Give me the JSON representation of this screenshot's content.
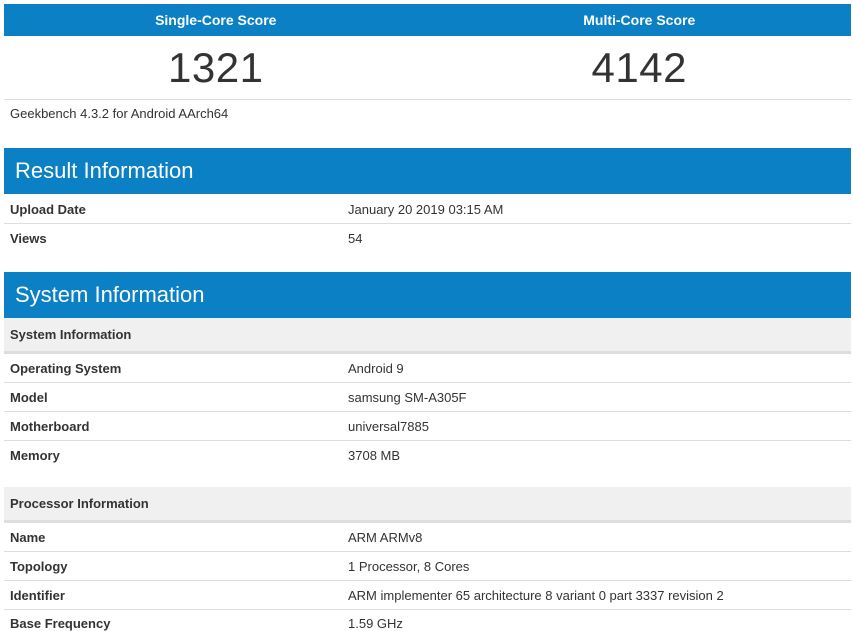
{
  "scores": {
    "single_core_label": "Single-Core Score",
    "multi_core_label": "Multi-Core Score",
    "single_core_value": "1321",
    "multi_core_value": "4142"
  },
  "version": "Geekbench 4.3.2 for Android AArch64",
  "result_info": {
    "title": "Result Information",
    "rows": [
      {
        "label": "Upload Date",
        "value": "January 20 2019 03:15 AM"
      },
      {
        "label": "Views",
        "value": "54"
      }
    ]
  },
  "system_info": {
    "title": "System Information",
    "system_sub": {
      "title": "System Information",
      "rows": [
        {
          "label": "Operating System",
          "value": "Android 9"
        },
        {
          "label": "Model",
          "value": "samsung SM-A305F"
        },
        {
          "label": "Motherboard",
          "value": "universal7885"
        },
        {
          "label": "Memory",
          "value": "3708 MB"
        }
      ]
    },
    "processor_sub": {
      "title": "Processor Information",
      "rows": [
        {
          "label": "Name",
          "value": "ARM ARMv8"
        },
        {
          "label": "Topology",
          "value": "1 Processor, 8 Cores"
        },
        {
          "label": "Identifier",
          "value": "ARM implementer 65 architecture 8 variant 0 part 3337 revision 2"
        },
        {
          "label": "Base Frequency",
          "value": "1.59 GHz"
        }
      ]
    }
  },
  "colors": {
    "header_blue": "#0b80c4",
    "subheader_grey": "#f0f0f0",
    "text": "#333333"
  }
}
